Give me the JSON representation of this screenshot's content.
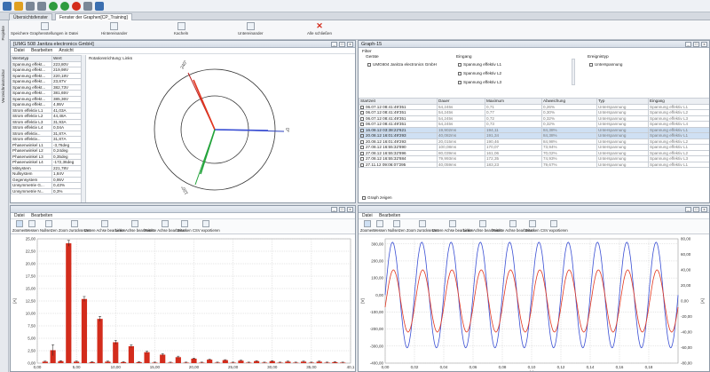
{
  "toolbar": {
    "icons": [
      "save-icon",
      "open-icon",
      "undo-icon",
      "redo-icon",
      "connect-icon",
      "add-icon",
      "record-icon",
      "import-icon",
      "refresh-icon"
    ]
  },
  "tabs": [
    {
      "label": "Übersichtsfenster",
      "active": false
    },
    {
      "label": "Fenster der Graphen[CP_Training]",
      "active": true
    }
  ],
  "ribbon": {
    "buttons": [
      "Speichere Graphenstellungen in Datei",
      "Hintereinander",
      "Kacheln",
      "Untereinander",
      "Alle schließen"
    ]
  },
  "sidebar": {
    "items": [
      "Projekte",
      "Verzeichnisstruktur"
    ]
  },
  "phasor_panel": {
    "title": "[UMG 508 Janitza electronics GmbH]",
    "menu": [
      "Datei",
      "Bearbeiten",
      "Ansicht"
    ],
    "headers": [
      "Wertetyp",
      "Wert"
    ],
    "rows": [
      [
        "Spannung effekt...",
        "223,80V"
      ],
      [
        "Spannung effekt...",
        "219,98V"
      ],
      [
        "Spannung effekt...",
        "220,18V"
      ],
      [
        "Spannung effekt...",
        "23,87V"
      ],
      [
        "Spannung effekt...",
        "382,73V"
      ],
      [
        "Spannung effekt...",
        "381,65V"
      ],
      [
        "Spannung effekt...",
        "385,36V"
      ],
      [
        "Spannung effekt...",
        "4,95V"
      ],
      [
        "Strom effektiv L1",
        "41,03A"
      ],
      [
        "Strom effektiv L2",
        "44,48A"
      ],
      [
        "Strom effektiv L3",
        "31,93A"
      ],
      [
        "Strom effektiv L4",
        "0,04A"
      ],
      [
        "Strom effektiv...",
        "31,87A"
      ],
      [
        "Strom effektiv...",
        "31,87A"
      ],
      [
        "Phasenwinkel L1",
        "-3,76deg"
      ],
      [
        "Phasenwinkel L2",
        "0,24deg"
      ],
      [
        "Phasenwinkel L3",
        "0,35deg"
      ],
      [
        "Phasenwinkel L4",
        "-172,36deg"
      ],
      [
        "Mitsystem",
        "221,78V"
      ],
      [
        "Nullsystem",
        "1,84V"
      ],
      [
        "Gegensystem",
        "0,95V"
      ],
      [
        "Unsymmetrie G...",
        "0,43%"
      ],
      [
        "Unsymmetrie N...",
        "0,3%"
      ]
    ],
    "rotation_label": "Rotationsrichtung: Links",
    "angle_labels": {
      "top": "240°",
      "right": "0°",
      "bottom": "120°"
    }
  },
  "graph_panel": {
    "title": "Graph-15",
    "filter_label": "Filter",
    "geraete_label": "Geräte",
    "geraet": "UMG604 Janitza electronics GmbH",
    "eingang_label": "Eingang",
    "eingang_items": [
      "Spannung effektiv L1",
      "Spannung effektiv L2",
      "Spannung effektiv L3"
    ],
    "ereignis_label": "Ereignistyp",
    "ereignis_item": "Unterspannung",
    "columns": [
      "Startzeit",
      "Dauer",
      "Maximum",
      "Abweichung",
      "Typ",
      "Eingang"
    ],
    "rows": [
      [
        "06.07.12 08:41:49'351",
        "54,245s",
        "0,71",
        "0,26%",
        "Unterspannung",
        "Spannung effektiv L1"
      ],
      [
        "06.07.12 08:41:49'351",
        "54,245s",
        "0,77",
        "0,30%",
        "Unterspannung",
        "Spannung effektiv L2"
      ],
      [
        "06.07.12 08:41:49'351",
        "54,245s",
        "0,72",
        "0,32%",
        "Unterspannung",
        "Spannung effektiv L3"
      ],
      [
        "06.07.12 08:41:49'351",
        "54,245s",
        "0,73",
        "0,32%",
        "Unterspannung",
        "Spannung effektiv L4"
      ],
      [
        "16.08.12 03:38:22'621",
        "19,902ms",
        "194,11",
        "84,38%",
        "Unterspannung",
        "Spannung effektiv L1"
      ],
      [
        "20.08.12 16:01:49'293",
        "40,082ms",
        "191,34",
        "84,38%",
        "Unterspannung",
        "Spannung effektiv L1"
      ],
      [
        "20.08.12 16:01:49'293",
        "20,015ms",
        "190,46",
        "84,98%",
        "Unterspannung",
        "Spannung effektiv L2"
      ],
      [
        "27.08.12 16:55:32'890",
        "100,08ms",
        "170,07",
        "73,94%",
        "Unterspannung",
        "Spannung effektiv L1"
      ],
      [
        "27.08.12 16:55:32'896",
        "80,039ms",
        "161,06",
        "70,02%",
        "Unterspannung",
        "Spannung effektiv L2"
      ],
      [
        "27.08.12 16:55:32'884",
        "79,993ms",
        "172,35",
        "74,93%",
        "Unterspannung",
        "Spannung effektiv L3"
      ],
      [
        "27.11.12 09:06:07'295",
        "40,059ms",
        "183,23",
        "79,67%",
        "Unterspannung",
        "Spannung effektiv L1"
      ]
    ],
    "show_graph": "Graph zeigen"
  },
  "harmonic_panel": {
    "menu": [
      "Datei",
      "Bearbeiten"
    ],
    "tools": [
      "Zoomen",
      "Messen",
      "Nullsetzen",
      "Zoom zurücksetzen",
      "Untere Achse bearbeiten",
      "Linke Achse bearbeiten",
      "Rechte Achse bearbeiten",
      "Drucken",
      "CSV exportieren"
    ]
  },
  "waveform_panel": {
    "menu": [
      "Datei",
      "Bearbeiten"
    ],
    "tools": [
      "Zoomen",
      "Messen",
      "Nullsetzen",
      "Zoom zurücksetzen",
      "Untere Achse bearbeiten",
      "Linke Achse bearbeiten",
      "Rechte Achse bearbeiten",
      "Drucken",
      "CSV exportieren"
    ]
  },
  "colors": {
    "accent": "#3b6fb0",
    "bar": "#d32c1c",
    "voltage": "#3a4fd4",
    "current": "#e2361f",
    "phasor_green": "#22a33a"
  },
  "chart_data": [
    {
      "type": "bar",
      "title": "",
      "xlabel": "",
      "ylabel": "[A]",
      "xticks": [
        "0,00",
        "5,00",
        "10,00",
        "15,00",
        "20,00",
        "25,00",
        "30,00",
        "35,00",
        "40,1"
      ],
      "yticks": [
        "0,00",
        "2,50",
        "5,00",
        "7,50",
        "10,00",
        "12,50",
        "15,00",
        "17,50",
        "20,00",
        "22,50",
        "25,00"
      ],
      "xlim": [
        0,
        40
      ],
      "ylim": [
        0,
        25
      ],
      "categories": [
        1,
        2,
        3,
        4,
        5,
        6,
        7,
        8,
        9,
        10,
        11,
        12,
        13,
        14,
        15,
        16,
        17,
        18,
        19,
        20,
        21,
        22,
        23,
        24,
        25,
        26,
        27,
        28,
        29,
        30,
        31,
        32,
        33,
        34,
        35,
        36,
        37,
        38,
        39
      ],
      "values": [
        0.3,
        2.6,
        0.4,
        24.1,
        0.3,
        12.9,
        0.2,
        8.9,
        0.3,
        4.2,
        0.2,
        3.4,
        0.2,
        2.2,
        0.1,
        1.7,
        0.1,
        1.2,
        0.1,
        0.9,
        0.1,
        0.7,
        0.1,
        0.6,
        0.1,
        0.5,
        0.1,
        0.4,
        0.1,
        0.4,
        0.1,
        0.3,
        0.1,
        0.3,
        0.1,
        0.3,
        0.1,
        0.2,
        0.1
      ],
      "errors": [
        0.1,
        1.1,
        0.1,
        0.6,
        0.1,
        0.5,
        0.1,
        0.5,
        0.1,
        0.4,
        0.1,
        0.3,
        0.1,
        0.2,
        0.1,
        0.2,
        0.1,
        0.2,
        0.1,
        0.1,
        0.1,
        0.1,
        0.1,
        0.1,
        0.1,
        0.1,
        0.1,
        0.1,
        0.1,
        0.1,
        0.1,
        0.1,
        0.1,
        0.1,
        0.1,
        0.1,
        0.1,
        0.1,
        0.1
      ]
    },
    {
      "type": "line",
      "title": "",
      "xlabel": "[s]",
      "ylabel": "[V]",
      "y2label": "[A]",
      "xticks": [
        "0,00",
        "0,02",
        "0,04",
        "0,06",
        "0,08",
        "0,10",
        "0,12",
        "0,14",
        "0,16",
        "0,18"
      ],
      "yticks": [
        "-400,00",
        "-300,00",
        "-200,00",
        "-100,00",
        "0,00",
        "100,00",
        "200,00",
        "300,00"
      ],
      "y2ticks": [
        "-80,00",
        "-60,00",
        "-40,00",
        "-20,00",
        "0,00",
        "20,00",
        "40,00",
        "60,00",
        "80,00"
      ],
      "xlim": [
        0,
        0.2
      ],
      "ylim": [
        -400,
        330
      ],
      "y2lim": [
        -80,
        80
      ],
      "series": [
        {
          "unit": "V",
          "amplitude": 310,
          "frequency": 50,
          "phase": 0
        },
        {
          "unit": "A",
          "amplitude": 40,
          "frequency": 50,
          "phase": -0.2
        }
      ]
    }
  ]
}
